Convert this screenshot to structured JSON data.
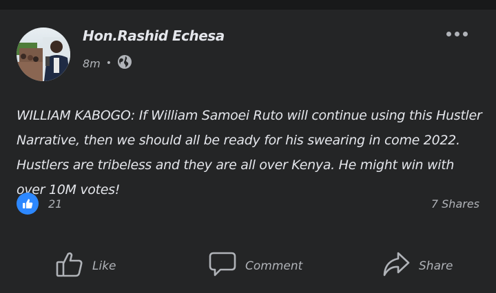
{
  "post": {
    "author": "Hon.Rashid Echesa",
    "time": "8m",
    "separator": "•",
    "privacy_icon": "globe-icon",
    "text": "WILLIAM KABOGO: If William Samoei Ruto will continue using this Hustler Narrative, then we should all be ready for his swearing in come 2022. Hustlers are tribeless and they are all over Kenya. He might win with over 10M votes!",
    "like_count": "21",
    "shares": "7 Shares"
  },
  "actions": {
    "like": "Like",
    "comment": "Comment",
    "share": "Share"
  },
  "colors": {
    "background": "#242526",
    "text": "#e4e6eb",
    "muted": "#b0b3b8",
    "like_blue": "#2d88ff"
  }
}
